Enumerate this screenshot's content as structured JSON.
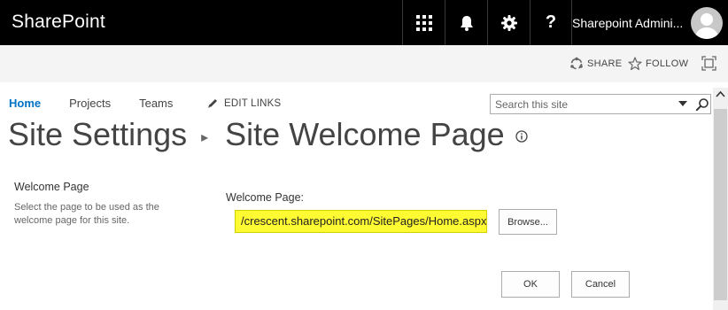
{
  "suitebar": {
    "brand": "SharePoint",
    "help_label": "?",
    "user_name": "Sharepoint Admini..."
  },
  "actionbar": {
    "share_label": "SHARE",
    "follow_label": "FOLLOW"
  },
  "topnav": {
    "items": [
      {
        "label": "Home",
        "active": true
      },
      {
        "label": "Projects",
        "active": false
      },
      {
        "label": "Teams",
        "active": false
      }
    ],
    "edit_links_label": "EDIT LINKS"
  },
  "search": {
    "placeholder": "Search this site"
  },
  "title": {
    "parent": "Site Settings",
    "current": "Site Welcome Page"
  },
  "form": {
    "section_title": "Welcome Page",
    "section_description": "Select the page to be used as the welcome page for this site.",
    "field_label": "Welcome Page:",
    "field_value": "/crescent.sharepoint.com/SitePages/Home.aspx",
    "browse_label": "Browse...",
    "ok_label": "OK",
    "cancel_label": "Cancel"
  },
  "colors": {
    "suitebar_bg": "#000000",
    "accent": "#0072c6",
    "highlight": "#fffb33"
  },
  "icons": [
    "app-launcher-icon",
    "bell-icon",
    "gear-icon",
    "help-icon",
    "share-icon",
    "star-icon",
    "focus-icon",
    "pencil-icon",
    "search-icon",
    "info-icon"
  ]
}
